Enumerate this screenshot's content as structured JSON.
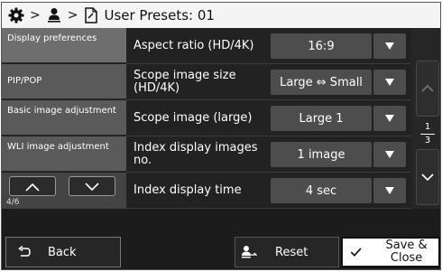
{
  "header": {
    "separator": ">",
    "title": "User Presets: 01",
    "icons": [
      "gear-icon",
      "user-icon",
      "document-icon"
    ]
  },
  "sidebar": {
    "items": [
      {
        "label": "Display preferences",
        "active": true
      },
      {
        "label": "PIP/POP",
        "active": false
      },
      {
        "label": "Basic image adjustment",
        "active": false
      },
      {
        "label": "WLI image adjustment",
        "active": false
      }
    ],
    "pager": {
      "page": "4/6",
      "icons": [
        "chevron-up-icon",
        "chevron-down-icon"
      ]
    }
  },
  "settings": [
    {
      "label": "Aspect ratio (HD/4K)",
      "value": "16:9"
    },
    {
      "label": "Scope image size (HD/4K)",
      "value": "Large ⇔ Small"
    },
    {
      "label": "Scope image (large)",
      "value": "Large 1"
    },
    {
      "label": "Index display images no.",
      "value": "1 image"
    },
    {
      "label": "Index display time",
      "value": "4 sec"
    }
  ],
  "scroll": {
    "page_current": "1",
    "page_total": "3"
  },
  "bottom": {
    "back_label": "Back",
    "reset_label": "Reset",
    "save_label": "Save & Close"
  },
  "colors": {
    "background": "#1c1c1c",
    "header": "#f4f4f4",
    "sidebar": "#5a5a5a",
    "value_box": "#4d4d4d",
    "save_button": "#ffffff"
  }
}
